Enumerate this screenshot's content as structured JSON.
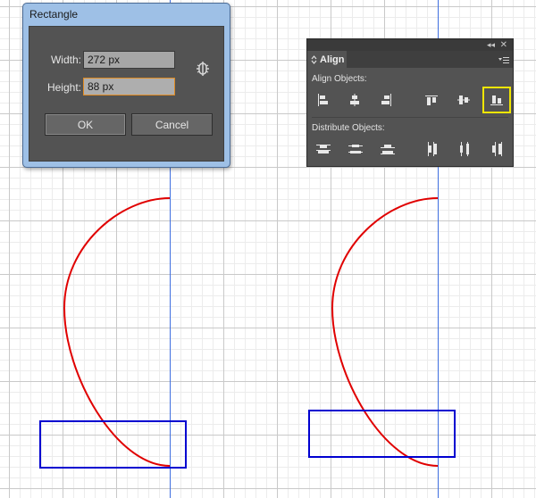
{
  "dialog": {
    "title": "Rectangle",
    "width_label": "Width:",
    "width_value": "272 px",
    "height_label": "Height:",
    "height_value": "88 px",
    "link_icon": "link-constrain-icon",
    "ok_label": "OK",
    "cancel_label": "Cancel"
  },
  "align_panel": {
    "tab_label": "Align",
    "align_objects_label": "Align Objects:",
    "distribute_objects_label": "Distribute Objects:",
    "align_buttons": [
      "horizontal-align-left-icon",
      "horizontal-align-center-icon",
      "horizontal-align-right-icon",
      "vertical-align-top-icon",
      "vertical-align-center-icon",
      "vertical-align-bottom-icon"
    ],
    "distribute_buttons": [
      "vertical-distribute-top-icon",
      "vertical-distribute-center-icon",
      "vertical-distribute-bottom-icon",
      "horizontal-distribute-left-icon",
      "horizontal-distribute-center-icon",
      "horizontal-distribute-right-icon"
    ],
    "selected_button": "vertical-align-bottom-icon"
  },
  "colors": {
    "guide": "#3f6fe0",
    "path_stroke": "#e00000",
    "rectangle_stroke": "#0000d0",
    "highlight": "#f0e600",
    "panel_bg": "#535353"
  }
}
